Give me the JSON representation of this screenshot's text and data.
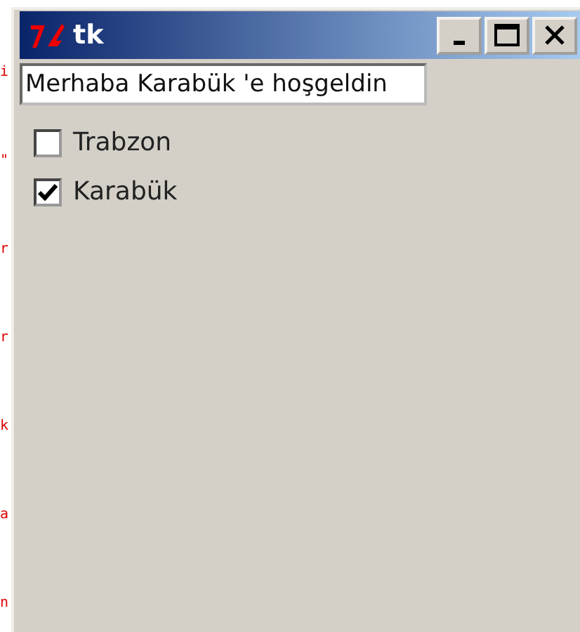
{
  "background_text": [
    "i",
    "\"",
    "r",
    "r",
    "k",
    "a",
    "n"
  ],
  "window": {
    "title": "tk",
    "buttons": [
      {
        "kind": "minimize"
      },
      {
        "kind": "maximize"
      },
      {
        "kind": "close"
      }
    ]
  },
  "entry": {
    "value": "Merhaba Karabük 'e hoşgeldin"
  },
  "checkboxes": [
    {
      "label": "Trabzon",
      "checked": false
    },
    {
      "label": "Karabük",
      "checked": true
    }
  ]
}
